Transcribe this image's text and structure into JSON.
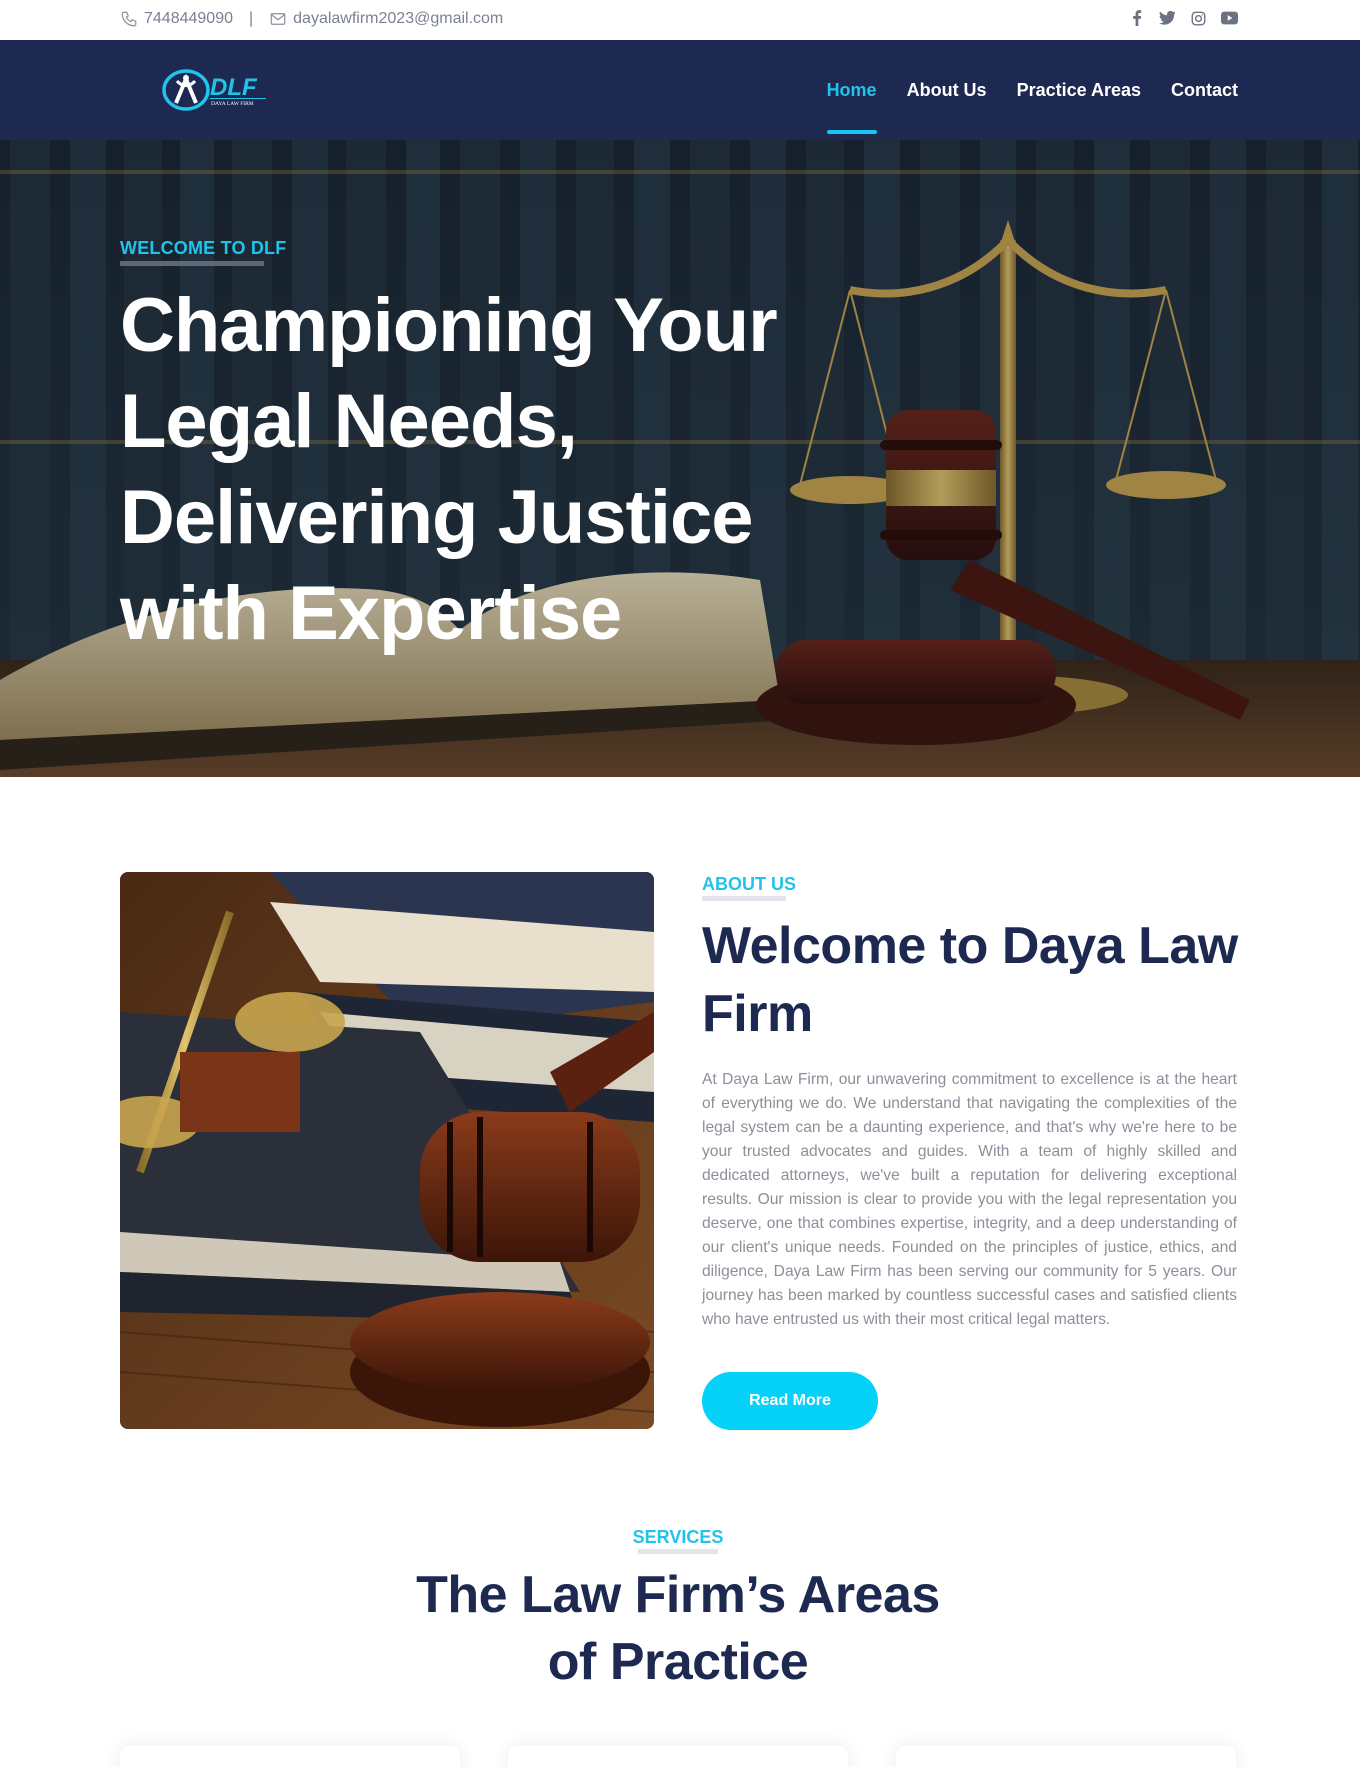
{
  "topbar": {
    "phone": "7448449090",
    "separator": "|",
    "email": "dayalawfirm2023@gmail.com",
    "social_icons": [
      "facebook-icon",
      "twitter-icon",
      "instagram-icon",
      "youtube-icon"
    ]
  },
  "nav": {
    "logo_text": "DLF",
    "logo_subtext": "DAYA LAW FIRM",
    "items": [
      {
        "label": "Home",
        "active": true
      },
      {
        "label": "About Us",
        "active": false
      },
      {
        "label": "Practice Areas",
        "active": false
      },
      {
        "label": "Contact",
        "active": false
      }
    ]
  },
  "hero": {
    "eyebrow": "WELCOME TO DLF",
    "title": "Championing Your Legal Needs, Delivering Justice with Expertise"
  },
  "about": {
    "eyebrow": "ABOUT US",
    "title": "Welcome to Daya Law Firm",
    "text": "At Daya Law Firm, our unwavering commitment to excellence is at the heart of everything we do. We understand that navigating the complexities of the legal system can be a daunting experience, and that's why we're here to be your trusted advocates and guides. With a team of highly skilled and dedicated attorneys, we've built a reputation for delivering exceptional results. Our mission is clear to provide you with the legal representation you deserve, one that combines expertise, integrity, and a deep understanding of our client's unique needs. Founded on the principles of justice, ethics, and diligence, Daya Law Firm has been serving our community for 5 years. Our journey has been marked by countless successful cases and satisfied clients who have entrusted us with their most critical legal matters.",
    "button": "Read More"
  },
  "services": {
    "eyebrow": "SERVICES",
    "title_line1": "The Law Firm’s Areas",
    "title_line2": "of Practice"
  },
  "colors": {
    "navy": "#1d2951",
    "accent": "#22c3ea",
    "button": "#06d1f8",
    "body_text": "#8a8f9a"
  }
}
